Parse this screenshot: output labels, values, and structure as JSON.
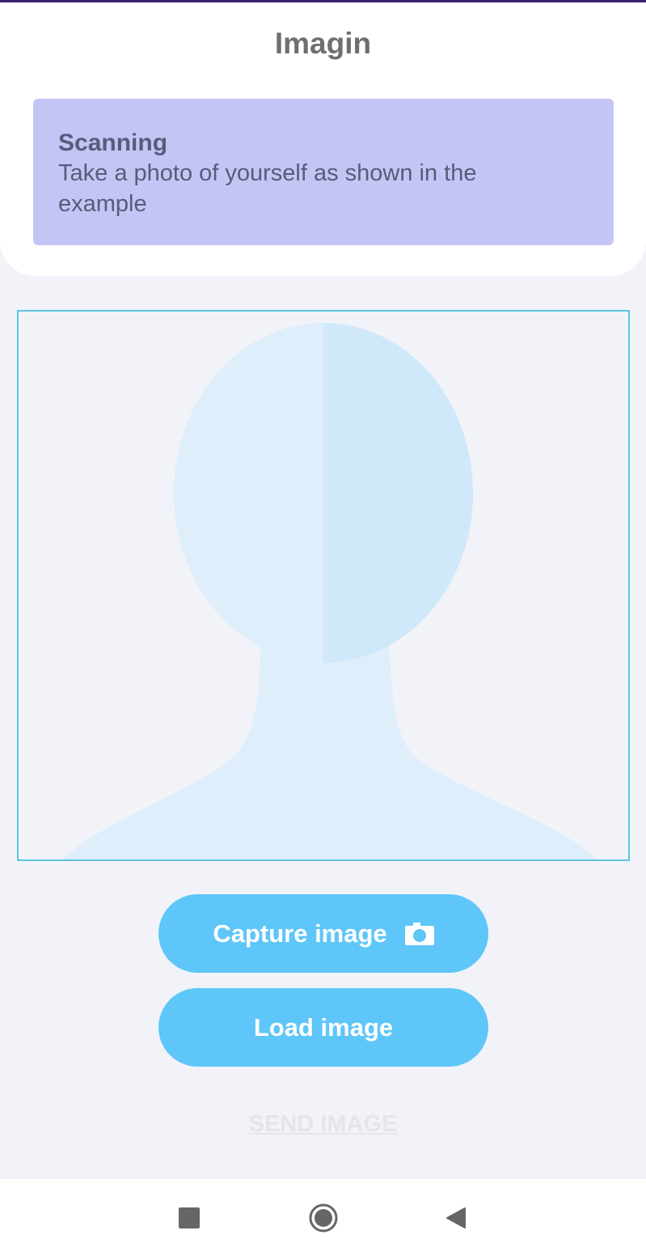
{
  "app": {
    "title": "Imagin"
  },
  "info": {
    "title": "Scanning",
    "text": "Take a photo of yourself as shown in the example"
  },
  "actions": {
    "capture_label": "Capture image",
    "load_label": "Load image",
    "send_label": "SEND IMAGE"
  },
  "icons": {
    "capture": "camera-icon",
    "recents": "square-icon",
    "home": "circle-icon",
    "back": "triangle-back-icon"
  },
  "colors": {
    "accent": "#5ec6f8",
    "info_background": "#c3c6f5",
    "frame_border": "#5ec5e0",
    "silhouette": "#deeefb",
    "silhouette_highlight": "#cfe8fa",
    "send_disabled": "#e4e5ec",
    "top_line": "#3b1d6e"
  }
}
